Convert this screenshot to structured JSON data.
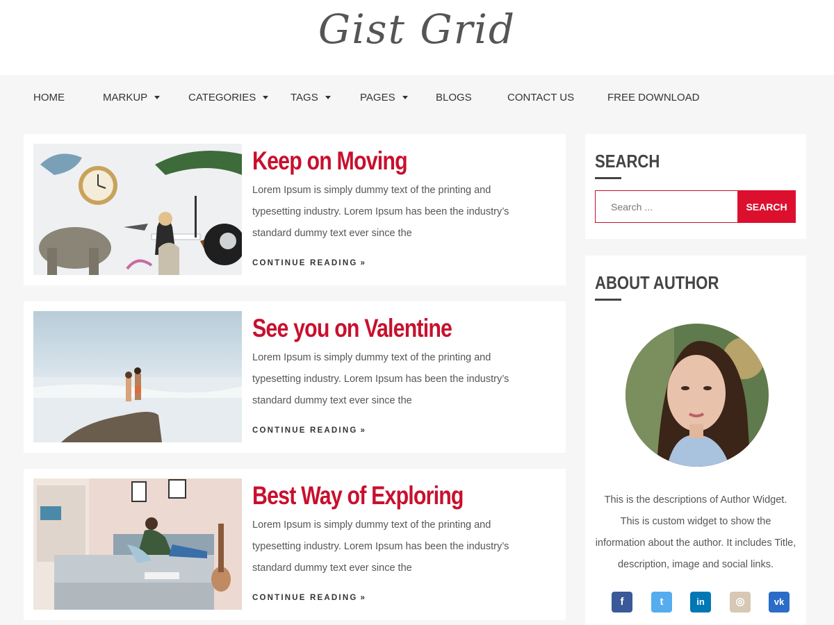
{
  "site": {
    "logo": "Gist Grid"
  },
  "nav": {
    "items": [
      {
        "label": "HOME",
        "has_dropdown": false
      },
      {
        "label": "MARKUP",
        "has_dropdown": true
      },
      {
        "label": "CATEGORIES",
        "has_dropdown": true
      },
      {
        "label": "TAGS",
        "has_dropdown": true
      },
      {
        "label": "PAGES",
        "has_dropdown": true
      },
      {
        "label": "BLOGS",
        "has_dropdown": false
      },
      {
        "label": "CONTACT US",
        "has_dropdown": false
      },
      {
        "label": "FREE DOWNLOAD",
        "has_dropdown": false
      }
    ]
  },
  "posts": [
    {
      "title": "Keep on Moving",
      "excerpt": "Lorem Ipsum is simply dummy text of the printing and typesetting industry. Lorem Ipsum has been the industry’s standard dummy text ever since the",
      "read_more": "CONTINUE READING"
    },
    {
      "title": "See you on Valentine",
      "excerpt": "Lorem Ipsum is simply dummy text of the printing and typesetting industry. Lorem Ipsum has been the industry’s standard dummy text ever since the",
      "read_more": "CONTINUE READING"
    },
    {
      "title": "Best Way of Exploring",
      "excerpt": "Lorem Ipsum is simply dummy text of the printing and typesetting industry. Lorem Ipsum has been the industry’s standard dummy text ever since the",
      "read_more": "CONTINUE READING"
    }
  ],
  "sidebar": {
    "search": {
      "title": "SEARCH",
      "placeholder": "Search ...",
      "button": "SEARCH"
    },
    "about": {
      "title": "ABOUT AUTHOR",
      "description": "This is the descriptions of Author Widget. This is custom widget to show the information about the author. It includes Title, description, image and social links.",
      "social": [
        {
          "icon": "facebook-icon",
          "glyph": "f",
          "color": "#3b5998"
        },
        {
          "icon": "twitter-icon",
          "glyph": "t",
          "color": "#55acee"
        },
        {
          "icon": "linkedin-icon",
          "glyph": "in",
          "color": "#0077b5"
        },
        {
          "icon": "instagram-icon",
          "glyph": "◎",
          "color": "#d6c8b4"
        },
        {
          "icon": "vk-icon",
          "glyph": "vk",
          "color": "#2b6cc8"
        }
      ]
    }
  },
  "colors": {
    "accent": "#c8102e",
    "button": "#dc0f2f",
    "text": "#555555",
    "background": "#f6f6f6"
  }
}
